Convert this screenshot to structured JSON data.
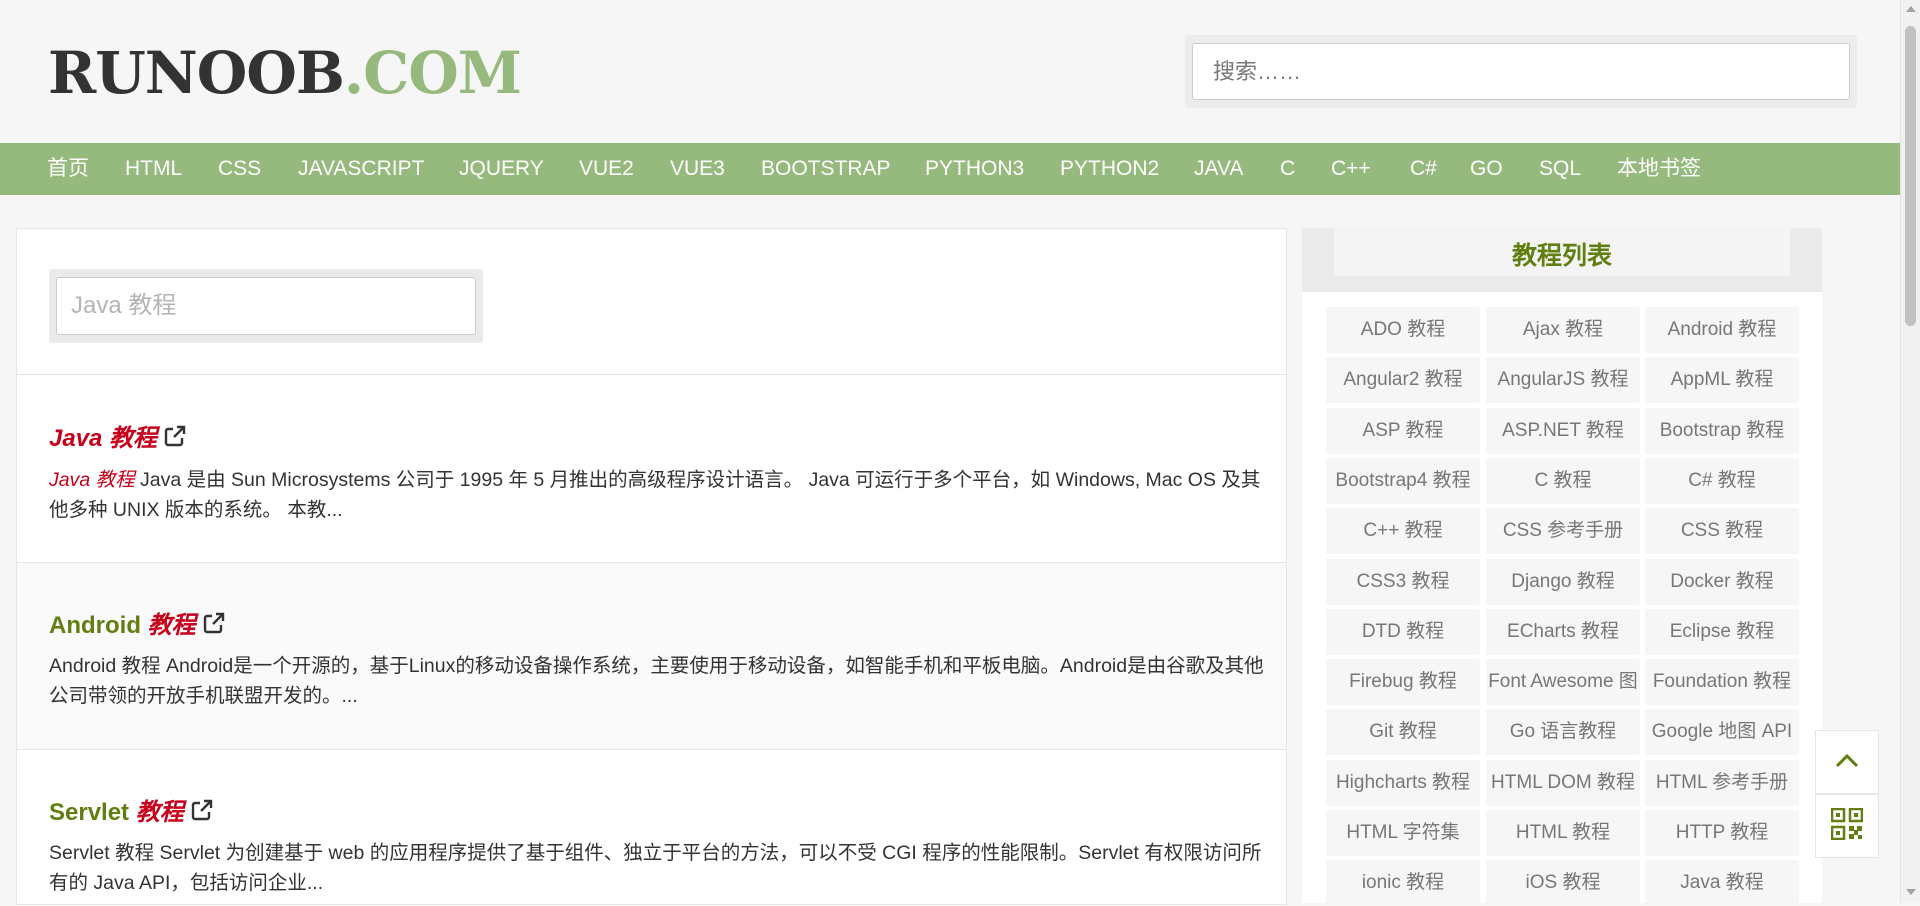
{
  "header": {
    "logo_main": "RUNOOB",
    "logo_accent": ".COM",
    "search_placeholder": "搜索……"
  },
  "nav": {
    "items": [
      "首页",
      "HTML",
      "CSS",
      "JAVASCRIPT",
      "JQUERY",
      "VUE2",
      "VUE3",
      "BOOTSTRAP",
      "PYTHON3",
      "PYTHON2",
      "JAVA",
      "C",
      "C++",
      "C#",
      "GO",
      "SQL",
      "本地书签"
    ]
  },
  "main": {
    "filter_placeholder": "Java 教程",
    "results": [
      {
        "title_prefix": "Java",
        "title_suffix": "教程",
        "desc_highlight": "Java 教程",
        "desc": " Java 是由 Sun Microsystems 公司于 1995 年 5 月推出的高级程序设计语言。 Java 可运行于多个平台，如 Windows, Mac OS 及其他多种 UNIX 版本的系统。 本教..."
      },
      {
        "title_prefix": "Android",
        "title_suffix": "教程",
        "desc_highlight": "",
        "desc": "Android 教程 Android是一个开源的，基于Linux的移动设备操作系统，主要使用于移动设备，如智能手机和平板电脑。Android是由谷歌及其他公司带领的开放手机联盟开发的。..."
      },
      {
        "title_prefix": "Servlet",
        "title_suffix": "教程",
        "desc_highlight": "",
        "desc": "Servlet 教程 Servlet 为创建基于 web 的应用程序提供了基于组件、独立于平台的方法，可以不受 CGI 程序的性能限制。Servlet 有权限访问所有的 Java API，包括访问企业..."
      }
    ]
  },
  "sidebar": {
    "title": "教程列表",
    "tiles": [
      "ADO 教程",
      "Ajax 教程",
      "Android 教程",
      "Angular2 教程",
      "AngularJS 教程",
      "AppML 教程",
      "ASP 教程",
      "ASP.NET 教程",
      "Bootstrap 教程",
      "Bootstrap4 教程",
      "C 教程",
      "C# 教程",
      "C++ 教程",
      "CSS 参考手册",
      "CSS 教程",
      "CSS3 教程",
      "Django 教程",
      "Docker 教程",
      "DTD 教程",
      "ECharts 教程",
      "Eclipse 教程",
      "Firebug 教程",
      "Font Awesome 图",
      "Foundation 教程",
      "Git 教程",
      "Go 语言教程",
      "Google 地图 API",
      "Highcharts 教程",
      "HTML DOM 教程",
      "HTML 参考手册",
      "HTML 字符集",
      "HTML 教程",
      "HTTP 教程",
      "ionic 教程",
      "iOS 教程",
      "Java 教程"
    ]
  },
  "icons": {
    "external_link": "external-link-icon",
    "back_to_top": "chevron-up-icon",
    "qr_code": "qr-code-icon"
  },
  "colors": {
    "brand_green": "#96b97d",
    "title_green": "#617f10",
    "highlight_red": "#c7001b"
  }
}
